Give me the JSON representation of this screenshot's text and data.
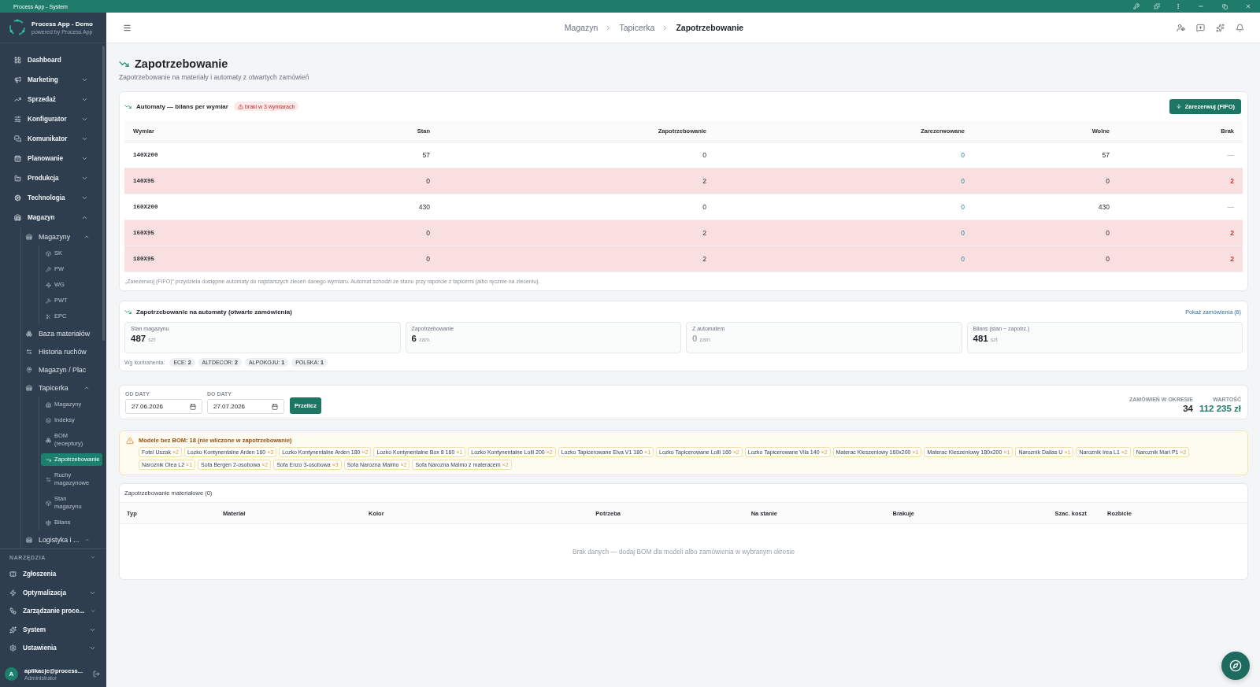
{
  "window": {
    "title": "Process App - System"
  },
  "sidebar": {
    "app_name": "Process App - Demo",
    "app_tagline": "powered by Process App",
    "items": [
      {
        "label": "Dashboard",
        "selected": false
      },
      {
        "label": "Marketing",
        "selected": false,
        "expanded": false
      },
      {
        "label": "Sprzedaż",
        "selected": false,
        "expanded": false
      },
      {
        "label": "Konfigurator",
        "selected": false,
        "expanded": false
      },
      {
        "label": "Komunikator",
        "selected": false,
        "expanded": false
      },
      {
        "label": "Planowanie",
        "selected": false,
        "expanded": false
      },
      {
        "label": "Produkcja",
        "selected": false,
        "expanded": false
      },
      {
        "label": "Technologia",
        "selected": false,
        "expanded": false
      },
      {
        "label": "Magazyn",
        "selected": false,
        "expanded": true,
        "children": [
          {
            "label": "Magazyny",
            "selected": false,
            "expanded": true,
            "children": [
              {
                "label": "SK",
                "selected": false
              },
              {
                "label": "PW",
                "selected": false
              },
              {
                "label": "WG",
                "selected": false
              },
              {
                "label": "PWT",
                "selected": false
              },
              {
                "label": "EPC",
                "selected": false
              }
            ]
          },
          {
            "label": "Baza materiałów",
            "selected": false
          },
          {
            "label": "Historia ruchów",
            "selected": false
          },
          {
            "label": "Magazyn / Plac",
            "selected": false
          },
          {
            "label": "Tapicerka",
            "selected": false,
            "expanded": true,
            "children": [
              {
                "label": "Magazyny",
                "selected": false
              },
              {
                "label": "Indeksy",
                "selected": false
              },
              {
                "label": "BOM (receptury)",
                "selected": false
              },
              {
                "label": "Zapotrzebowanie",
                "selected": true
              },
              {
                "label": "Ruchy magazynowe",
                "selected": false
              },
              {
                "label": "Stan magazynu",
                "selected": false
              },
              {
                "label": "Bilans",
                "selected": false
              }
            ]
          },
          {
            "label": "Logistyka i ...",
            "selected": false,
            "expanded": true
          }
        ]
      }
    ],
    "tools": {
      "title": "NARZĘDZIA",
      "items": [
        {
          "label": "Zgłoszenia",
          "selected": false
        },
        {
          "label": "Optymalizacja",
          "selected": false,
          "expanded": false
        },
        {
          "label": "Zarządzanie proce...",
          "selected": false,
          "expanded": false
        },
        {
          "label": "System",
          "selected": false,
          "expanded": false
        },
        {
          "label": "Ustawienia",
          "selected": false,
          "expanded": false
        }
      ]
    },
    "user": {
      "initial": "A",
      "email": "aplikacje@process...",
      "role": "Administrator"
    }
  },
  "header": {
    "breadcrumbs": [
      {
        "label": "Magazyn",
        "current": false
      },
      {
        "label": "Tapicerka",
        "current": false
      },
      {
        "label": "Zapotrzebowanie",
        "current": true
      }
    ]
  },
  "page": {
    "title": "Zapotrzebowanie",
    "subtitle": "Zapotrzebowanie na materiały i automaty z otwartych zamówień"
  },
  "machines_balance": {
    "title": "Automaty — bilans per wymiar",
    "badge": "braki w 3 wymiarach",
    "button": "Zarezerwuj (FIFO)",
    "columns": [
      "Wymiar",
      "Stan",
      "Zapotrzebowanie",
      "Zarezerwowane",
      "Wolne",
      "Brak"
    ],
    "rows": [
      {
        "cells": [
          "140X200",
          "57",
          "0",
          "0",
          "57",
          "—"
        ],
        "shortage": false
      },
      {
        "cells": [
          "140X95",
          "0",
          "2",
          "0",
          "0",
          "2"
        ],
        "shortage": true
      },
      {
        "cells": [
          "160X200",
          "430",
          "0",
          "0",
          "430",
          "—"
        ],
        "shortage": false
      },
      {
        "cells": [
          "160X95",
          "0",
          "2",
          "0",
          "0",
          "2"
        ],
        "shortage": true
      },
      {
        "cells": [
          "180X95",
          "0",
          "2",
          "0",
          "0",
          "2"
        ],
        "shortage": true
      }
    ],
    "note": "„Zarezerwuj (FIFO)” przydziela dostępne automaty do najstarszych zleceń danego wymiaru. Automat schodzi ze stanu przy raporcie z tapicerni (albo ręcznie na zleceniu)."
  },
  "machine_demand": {
    "title": "Zapotrzebowanie na automaty (otwarte zamówienia)",
    "link": "Pokaż zamówienia (6)",
    "stats": [
      {
        "label": "Stan magazynu",
        "value": "487",
        "unit": "szt",
        "muted": false
      },
      {
        "label": "Zapotrzebowanie",
        "value": "6",
        "unit": "zam.",
        "muted": false
      },
      {
        "label": "Z automatem",
        "value": "0",
        "unit": "zam.",
        "muted": true
      },
      {
        "label": "Bilans (stan − zapotrz.)",
        "value": "481",
        "unit": "szt",
        "muted": false
      }
    ],
    "clients_label": "Wg kontrahenta:",
    "clients": [
      "ECE: **2**",
      "ALTDECOR: **2**",
      "ALPOKOJU: **1**",
      "POLSKA: **1**"
    ]
  },
  "period": {
    "from": {
      "label": "OD DATY",
      "value": "27.06.2026"
    },
    "to": {
      "label": "DO DATY",
      "value": "27.07.2026"
    },
    "button": "Przelicz",
    "summary": [
      {
        "label": "ZAMÓWIEŃ W OKRESIE",
        "value": "34",
        "kind": "count"
      },
      {
        "label": "WARTOŚĆ",
        "value": "112 235 zł",
        "kind": "money"
      }
    ]
  },
  "missing_bom": {
    "title": "Modele bez BOM: 18 (nie wliczone w zapotrzebowanie)",
    "models": [
      {
        "name": "Fotel Uszak",
        "count": "×2"
      },
      {
        "name": "Lozko Kontynentalne Arden 160",
        "count": "×3"
      },
      {
        "name": "Lozko Kontynentalne Arden 180",
        "count": "×2"
      },
      {
        "name": "Lozko Kontynentalne Box 8 160",
        "count": "×1"
      },
      {
        "name": "Lozko Kontynentalne Lolli 200",
        "count": "×2"
      },
      {
        "name": "Lozko Tapicerowane Elva V1 180",
        "count": "×1"
      },
      {
        "name": "Lozko Tapicerowane Lolli 160",
        "count": "×2"
      },
      {
        "name": "Lozko Tapicerowane Vila 140",
        "count": "×2"
      },
      {
        "name": "Materac Kieszeniowy 160x200",
        "count": "×1"
      },
      {
        "name": "Materac Kieszeniowy 180x200",
        "count": "×1"
      },
      {
        "name": "Naroznik Dallas U",
        "count": "×1"
      },
      {
        "name": "Naroznik Irea L1",
        "count": "×2"
      },
      {
        "name": "Naroznik Mari P1",
        "count": "×2"
      },
      {
        "name": "Naroznik Olea L2",
        "count": "×1"
      },
      {
        "name": "Sofa Bergen 2-osobowa",
        "count": "×2"
      },
      {
        "name": "Sofa Enzo 3-osobowa",
        "count": "×3"
      },
      {
        "name": "Sofa Narozna Malmo",
        "count": "×2"
      },
      {
        "name": "Sofa Narozna Malmo z materacem",
        "count": "×2"
      }
    ]
  },
  "materials": {
    "title": "Zapotrzebowanie materiałowe (0)",
    "columns": [
      "Typ",
      "Materiał",
      "Kolor",
      "Potrzeba",
      "Na stanie",
      "Brakuje",
      "Szac. koszt",
      "Rozbicie"
    ],
    "empty_text": "Brak danych — dodaj BOM dla modeli albo zamówienia w wybranym okresie"
  }
}
